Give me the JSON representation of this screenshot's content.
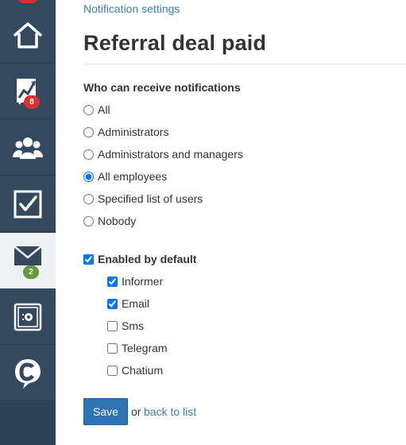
{
  "breadcrumb": "Notification settings",
  "title": "Referral deal paid",
  "recipients": {
    "label": "Who can receive notifications",
    "options": [
      "All",
      "Administrators",
      "Administrators and managers",
      "All employees",
      "Specified list of users",
      "Nobody"
    ],
    "selected": "All employees"
  },
  "enabled_by_default": {
    "label": "Enabled by default",
    "checked": true
  },
  "channels": [
    {
      "label": "Informer",
      "checked": true
    },
    {
      "label": "Email",
      "checked": true
    },
    {
      "label": "Sms",
      "checked": false
    },
    {
      "label": "Telegram",
      "checked": false
    },
    {
      "label": "Chatium",
      "checked": false
    }
  ],
  "actions": {
    "save_label": "Save",
    "or_text": "or",
    "back_link_label": "back to list"
  },
  "sidebar": {
    "items": [
      {
        "icon": "home-icon"
      },
      {
        "icon": "chart-trend-icon",
        "badge": "8",
        "badge_color": "#d9312f"
      },
      {
        "icon": "users-group-icon"
      },
      {
        "icon": "checkbox-task-icon"
      },
      {
        "icon": "mail-icon",
        "badge": "2",
        "badge_color": "#62993b",
        "active": true
      },
      {
        "icon": "safe-vault-icon"
      },
      {
        "icon": "chat-bubble-c-icon"
      }
    ]
  },
  "colors": {
    "sidebar_bg": "#34495e",
    "link": "#3d7cb1",
    "primary_button": "#2e74b5"
  }
}
